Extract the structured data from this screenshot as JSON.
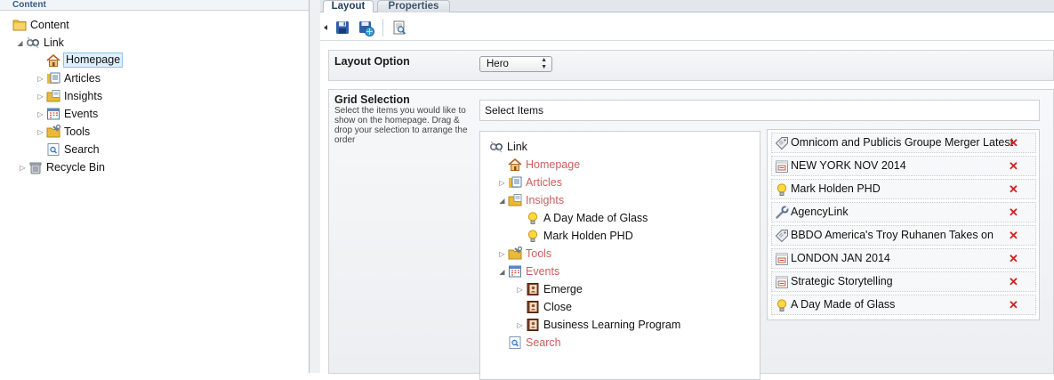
{
  "left_panel": {
    "header": "Content",
    "tree": [
      {
        "label": "Content",
        "icon": "folder-icon",
        "toggle": ""
      },
      {
        "label": "Link",
        "icon": "link-icon",
        "toggle": "expanded"
      },
      {
        "label": "Homepage",
        "icon": "home-icon",
        "toggle": "",
        "selected": true
      },
      {
        "label": "Articles",
        "icon": "articles-icon",
        "toggle": "collapsed"
      },
      {
        "label": "Insights",
        "icon": "insights-folder-icon",
        "toggle": "collapsed"
      },
      {
        "label": "Events",
        "icon": "events-icon",
        "toggle": "collapsed"
      },
      {
        "label": "Tools",
        "icon": "tools-icon",
        "toggle": "collapsed"
      },
      {
        "label": "Search",
        "icon": "search-page-icon",
        "toggle": ""
      },
      {
        "label": "Recycle Bin",
        "icon": "recycle-bin-icon",
        "toggle": "collapsed"
      }
    ]
  },
  "tabs": [
    {
      "label": "Layout",
      "active": true
    },
    {
      "label": "Properties",
      "active": false
    }
  ],
  "toolbar": {
    "icons": [
      "arrow-left-icon",
      "save-icon",
      "save-publish-icon",
      "preview-icon"
    ]
  },
  "layout_option": {
    "label": "Layout Option",
    "value": "Hero"
  },
  "grid_selection": {
    "label": "Grid Selection",
    "description": "Select the items you would like to show on the homepage. Drag & drop your selection to arrange the order",
    "select_items_label": "Select Items",
    "source_tree": [
      {
        "label": "Link",
        "icon": "link-icon",
        "toggle": "",
        "highlight": false
      },
      {
        "label": "Homepage",
        "icon": "home-icon",
        "toggle": "",
        "highlight": true
      },
      {
        "label": "Articles",
        "icon": "articles-icon",
        "toggle": "collapsed",
        "highlight": true
      },
      {
        "label": "Insights",
        "icon": "insights-folder-icon",
        "toggle": "expanded",
        "highlight": true
      },
      {
        "label": "A Day Made of Glass",
        "icon": "lightbulb-icon",
        "toggle": "",
        "highlight": false
      },
      {
        "label": "Mark Holden PHD",
        "icon": "lightbulb-icon",
        "toggle": "",
        "highlight": false
      },
      {
        "label": "Tools",
        "icon": "tools-icon",
        "toggle": "collapsed",
        "highlight": true
      },
      {
        "label": "Events",
        "icon": "events-icon",
        "toggle": "expanded",
        "highlight": true
      },
      {
        "label": "Emerge",
        "icon": "event-book-icon",
        "toggle": "collapsed",
        "highlight": false
      },
      {
        "label": "Close",
        "icon": "event-book-icon",
        "toggle": "",
        "highlight": false
      },
      {
        "label": "Business Learning Program",
        "icon": "event-book-icon",
        "toggle": "collapsed",
        "highlight": false
      },
      {
        "label": "Search",
        "icon": "search-page-icon",
        "toggle": "",
        "highlight": true
      }
    ],
    "selected_items": [
      {
        "label": "Omnicom and Publicis Groupe Merger Latest",
        "icon": "tag-icon"
      },
      {
        "label": "NEW YORK NOV 2014",
        "icon": "calendar-icon"
      },
      {
        "label": "Mark Holden PHD",
        "icon": "lightbulb-icon"
      },
      {
        "label": "AgencyLink",
        "icon": "wrench-icon"
      },
      {
        "label": "BBDO America's Troy Ruhanen Takes on",
        "icon": "tag-icon"
      },
      {
        "label": "LONDON JAN 2014",
        "icon": "calendar-icon"
      },
      {
        "label": "Strategic Storytelling",
        "icon": "calendar-icon"
      },
      {
        "label": "A Day Made of Glass",
        "icon": "lightbulb-icon"
      }
    ],
    "remove_symbol": "✕"
  }
}
